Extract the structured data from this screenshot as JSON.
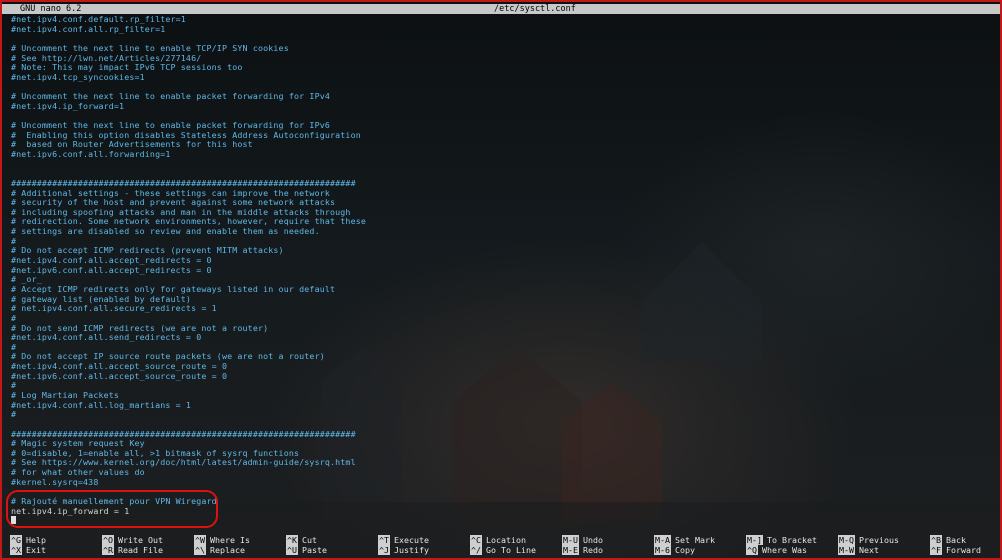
{
  "window": {
    "app_title": "GNU nano 6.2",
    "file_path": "/etc/sysctl.conf"
  },
  "editor": {
    "lines": [
      {
        "text": "#net.ipv4.conf.default.rp_filter=1",
        "type": "comment"
      },
      {
        "text": "#net.ipv4.conf.all.rp_filter=1",
        "type": "comment"
      },
      {
        "text": "",
        "type": "plain"
      },
      {
        "text": "# Uncomment the next line to enable TCP/IP SYN cookies",
        "type": "comment"
      },
      {
        "text": "# See http://lwn.net/Articles/277146/",
        "type": "comment"
      },
      {
        "text": "# Note: This may impact IPv6 TCP sessions too",
        "type": "comment"
      },
      {
        "text": "#net.ipv4.tcp_syncookies=1",
        "type": "comment"
      },
      {
        "text": "",
        "type": "plain"
      },
      {
        "text": "# Uncomment the next line to enable packet forwarding for IPv4",
        "type": "comment"
      },
      {
        "text": "#net.ipv4.ip_forward=1",
        "type": "comment"
      },
      {
        "text": "",
        "type": "plain"
      },
      {
        "text": "# Uncomment the next line to enable packet forwarding for IPv6",
        "type": "comment"
      },
      {
        "text": "#  Enabling this option disables Stateless Address Autoconfiguration",
        "type": "comment"
      },
      {
        "text": "#  based on Router Advertisements for this host",
        "type": "comment"
      },
      {
        "text": "#net.ipv6.conf.all.forwarding=1",
        "type": "comment"
      },
      {
        "text": "",
        "type": "plain"
      },
      {
        "text": "",
        "type": "plain"
      },
      {
        "text": "###################################################################",
        "type": "comment"
      },
      {
        "text": "# Additional settings - these settings can improve the network",
        "type": "comment"
      },
      {
        "text": "# security of the host and prevent against some network attacks",
        "type": "comment"
      },
      {
        "text": "# including spoofing attacks and man in the middle attacks through",
        "type": "comment"
      },
      {
        "text": "# redirection. Some network environments, however, require that these",
        "type": "comment"
      },
      {
        "text": "# settings are disabled so review and enable them as needed.",
        "type": "comment"
      },
      {
        "text": "#",
        "type": "comment"
      },
      {
        "text": "# Do not accept ICMP redirects (prevent MITM attacks)",
        "type": "comment"
      },
      {
        "text": "#net.ipv4.conf.all.accept_redirects = 0",
        "type": "comment"
      },
      {
        "text": "#net.ipv6.conf.all.accept_redirects = 0",
        "type": "comment"
      },
      {
        "text": "# _or_",
        "type": "comment"
      },
      {
        "text": "# Accept ICMP redirects only for gateways listed in our default",
        "type": "comment"
      },
      {
        "text": "# gateway list (enabled by default)",
        "type": "comment"
      },
      {
        "text": "# net.ipv4.conf.all.secure_redirects = 1",
        "type": "comment"
      },
      {
        "text": "#",
        "type": "comment"
      },
      {
        "text": "# Do not send ICMP redirects (we are not a router)",
        "type": "comment"
      },
      {
        "text": "#net.ipv4.conf.all.send_redirects = 0",
        "type": "comment"
      },
      {
        "text": "#",
        "type": "comment"
      },
      {
        "text": "# Do not accept IP source route packets (we are not a router)",
        "type": "comment"
      },
      {
        "text": "#net.ipv4.conf.all.accept_source_route = 0",
        "type": "comment"
      },
      {
        "text": "#net.ipv6.conf.all.accept_source_route = 0",
        "type": "comment"
      },
      {
        "text": "#",
        "type": "comment"
      },
      {
        "text": "# Log Martian Packets",
        "type": "comment"
      },
      {
        "text": "#net.ipv4.conf.all.log_martians = 1",
        "type": "comment"
      },
      {
        "text": "#",
        "type": "comment"
      },
      {
        "text": "",
        "type": "plain"
      },
      {
        "text": "###################################################################",
        "type": "comment"
      },
      {
        "text": "# Magic system request Key",
        "type": "comment"
      },
      {
        "text": "# 0=disable, 1=enable all, >1 bitmask of sysrq functions",
        "type": "comment"
      },
      {
        "text": "# See https://www.kernel.org/doc/html/latest/admin-guide/sysrq.html",
        "type": "comment"
      },
      {
        "text": "# for what other values do",
        "type": "comment"
      },
      {
        "text": "#kernel.sysrq=438",
        "type": "comment"
      },
      {
        "text": "",
        "type": "plain"
      },
      {
        "text": "# Rajouté manuellement pour VPN Wiregard",
        "type": "comment"
      },
      {
        "text": "net.ipv4.ip_forward = 1",
        "type": "plain"
      }
    ]
  },
  "shortcuts": [
    {
      "key": "^G",
      "label": "Help"
    },
    {
      "key": "^X",
      "label": "Exit"
    },
    {
      "key": "^O",
      "label": "Write Out"
    },
    {
      "key": "^R",
      "label": "Read File"
    },
    {
      "key": "^W",
      "label": "Where Is"
    },
    {
      "key": "^\\",
      "label": "Replace"
    },
    {
      "key": "^K",
      "label": "Cut"
    },
    {
      "key": "^U",
      "label": "Paste"
    },
    {
      "key": "^T",
      "label": "Execute"
    },
    {
      "key": "^J",
      "label": "Justify"
    },
    {
      "key": "^C",
      "label": "Location"
    },
    {
      "key": "^/",
      "label": "Go To Line"
    },
    {
      "key": "M-U",
      "label": "Undo"
    },
    {
      "key": "M-E",
      "label": "Redo"
    },
    {
      "key": "M-A",
      "label": "Set Mark"
    },
    {
      "key": "M-6",
      "label": "Copy"
    },
    {
      "key": "M-]",
      "label": "To Bracket"
    },
    {
      "key": "^Q",
      "label": "Where Was"
    },
    {
      "key": "M-Q",
      "label": "Previous"
    },
    {
      "key": "M-W",
      "label": "Next"
    },
    {
      "key": "^B",
      "label": "Back"
    },
    {
      "key": "^F",
      "label": "Forward"
    }
  ],
  "colors": {
    "comment": "#5fb8e8",
    "plain_text": "#d8d8d8",
    "title_bar": "#c8c8c8",
    "annotation": "#e01010",
    "window_border": "#c21818"
  }
}
